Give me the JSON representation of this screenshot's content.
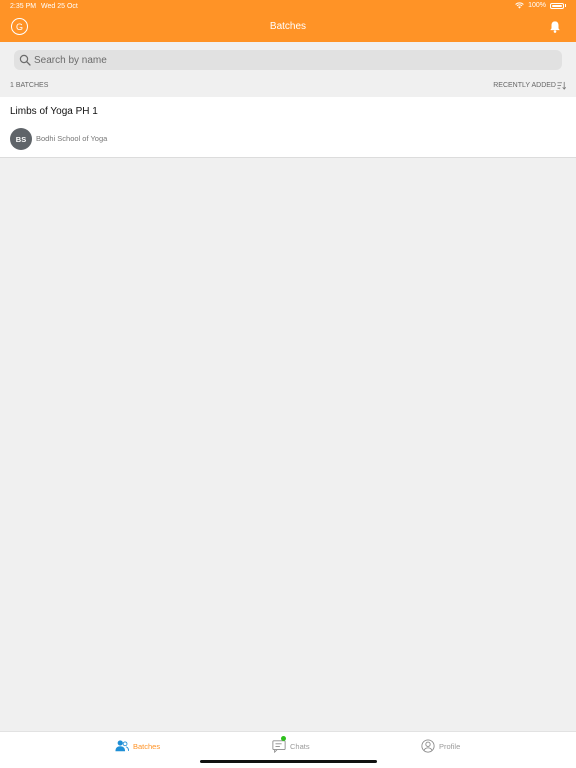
{
  "status_bar": {
    "time": "2:35 PM",
    "date": "Wed 25 Oct",
    "battery": "100%"
  },
  "header": {
    "avatar_initial": "G",
    "title": "Batches"
  },
  "search": {
    "placeholder": "Search by name"
  },
  "list_meta": {
    "count_label": "1 BATCHES",
    "sort_label": "RECENTLY ADDED"
  },
  "batches": [
    {
      "title": "Limbs of Yoga PH 1",
      "org_initials": "BS",
      "org_name": "Bodhi School of Yoga"
    }
  ],
  "tabs": [
    {
      "label": "Batches",
      "icon": "people-icon",
      "active": true
    },
    {
      "label": "Chats",
      "icon": "chat-icon",
      "active": false,
      "has_badge": true
    },
    {
      "label": "Profile",
      "icon": "profile-icon",
      "active": false
    }
  ],
  "colors": {
    "accent": "#ff9326",
    "badge": "#2ec01d",
    "avatar_bg": "#5f6469"
  }
}
